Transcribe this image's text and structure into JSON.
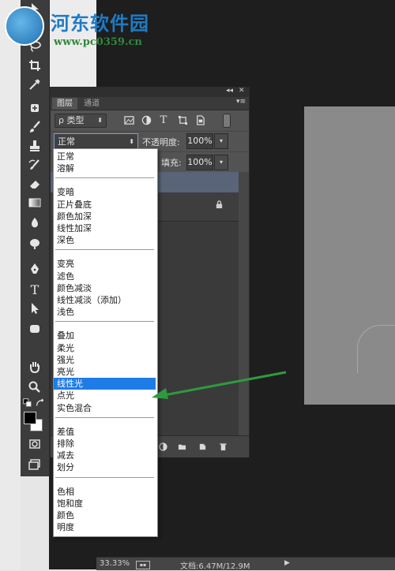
{
  "watermark": {
    "brand": "河东软件园",
    "url": "www.pc0359.cn"
  },
  "toolbar": {
    "tools": [
      "move-tool-icon",
      "marquee-tool-icon",
      "lasso-tool-icon",
      "crop-tool-icon",
      "eyedropper-tool-icon",
      "healing-brush-icon",
      "brush-tool-icon",
      "clone-stamp-icon",
      "history-brush-icon",
      "eraser-tool-icon",
      "gradient-tool-icon",
      "blur-tool-icon",
      "dodge-tool-icon",
      "pen-tool-icon",
      "type-tool-icon",
      "path-selection-icon",
      "shape-tool-icon",
      "hand-tool-icon",
      "zoom-tool-icon"
    ],
    "type_glyph": "T"
  },
  "panel": {
    "tabs": [
      "图层",
      "通道"
    ],
    "filter_label": "ρ 类型",
    "filter_arrow": "⬍",
    "blend_mode": "正常",
    "blend_arrow": "⬍",
    "opacity_label": "不透明度:",
    "opacity_value": "100%",
    "fill_label": "填充:",
    "fill_value": "100%",
    "dropdown_arrow": "▾",
    "collapse": "◂◂",
    "close": "✕",
    "menu": "▾≡"
  },
  "blend_menu": {
    "groups": [
      [
        "正常",
        "溶解"
      ],
      [
        "变暗",
        "正片叠底",
        "颜色加深",
        "线性加深",
        "深色"
      ],
      [
        "变亮",
        "滤色",
        "颜色减淡",
        "线性减淡（添加）",
        "浅色"
      ],
      [
        "叠加",
        "柔光",
        "强光",
        "亮光",
        "线性光",
        "点光",
        "实色混合"
      ],
      [
        "差值",
        "排除",
        "减去",
        "划分"
      ],
      [
        "色相",
        "饱和度",
        "颜色",
        "明度"
      ]
    ],
    "selected": "线性光",
    "highlight_color": "#1e7ce6"
  },
  "statusbar": {
    "zoom": "33.33%",
    "doc_info": "文档:6.47M/12.9M",
    "arrow": "▶"
  },
  "annotation": {
    "arrow_color": "#2f9a3c"
  }
}
